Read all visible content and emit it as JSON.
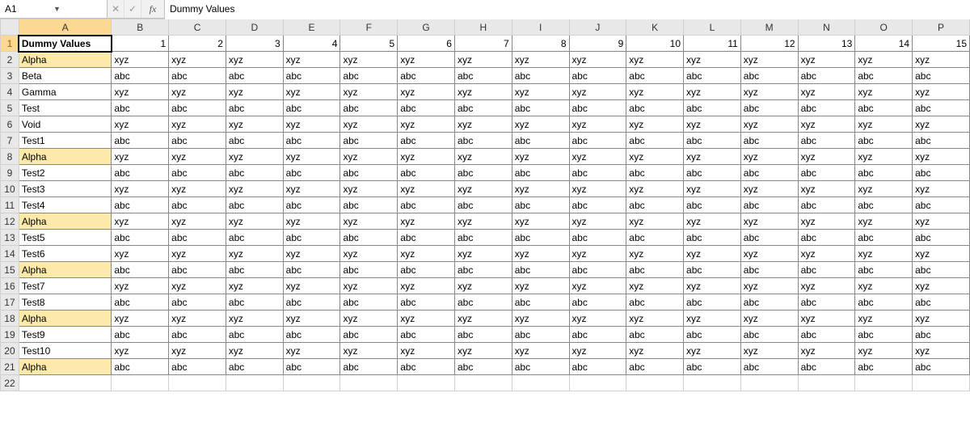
{
  "namebox": {
    "value": "A1"
  },
  "fx_label": "fx",
  "formula": "Dummy Values",
  "columns": [
    "A",
    "B",
    "C",
    "D",
    "E",
    "F",
    "G",
    "H",
    "I",
    "J",
    "K",
    "L",
    "M",
    "N",
    "O",
    "P"
  ],
  "header_numbers": [
    1,
    2,
    3,
    4,
    5,
    6,
    7,
    8,
    9,
    10,
    11,
    12,
    13,
    14,
    15
  ],
  "row_numbers": [
    1,
    2,
    3,
    4,
    5,
    6,
    7,
    8,
    9,
    10,
    11,
    12,
    13,
    14,
    15,
    16,
    17,
    18,
    19,
    20,
    21,
    22
  ],
  "colA_header": "Dummy Values",
  "rows": [
    {
      "label": "Alpha",
      "fill": "xyz",
      "highlight": true
    },
    {
      "label": "Beta",
      "fill": "abc"
    },
    {
      "label": "Gamma",
      "fill": "xyz"
    },
    {
      "label": "Test",
      "fill": "abc"
    },
    {
      "label": "Void",
      "fill": "xyz"
    },
    {
      "label": "Test1",
      "fill": "abc"
    },
    {
      "label": "Alpha",
      "fill": "xyz",
      "highlight": true
    },
    {
      "label": "Test2",
      "fill": "abc"
    },
    {
      "label": "Test3",
      "fill": "xyz"
    },
    {
      "label": "Test4",
      "fill": "abc"
    },
    {
      "label": "Alpha",
      "fill": "xyz",
      "highlight": true
    },
    {
      "label": "Test5",
      "fill": "abc"
    },
    {
      "label": "Test6",
      "fill": "xyz"
    },
    {
      "label": "Alpha",
      "fill": "abc",
      "highlight": true
    },
    {
      "label": "Test7",
      "fill": "xyz"
    },
    {
      "label": "Test8",
      "fill": "abc"
    },
    {
      "label": "Alpha",
      "fill": "xyz",
      "highlight": true
    },
    {
      "label": "Test9",
      "fill": "abc"
    },
    {
      "label": "Test10",
      "fill": "xyz"
    },
    {
      "label": "Alpha",
      "fill": "abc",
      "highlight": true
    }
  ],
  "active_cell": {
    "row": 1,
    "col": "A"
  }
}
